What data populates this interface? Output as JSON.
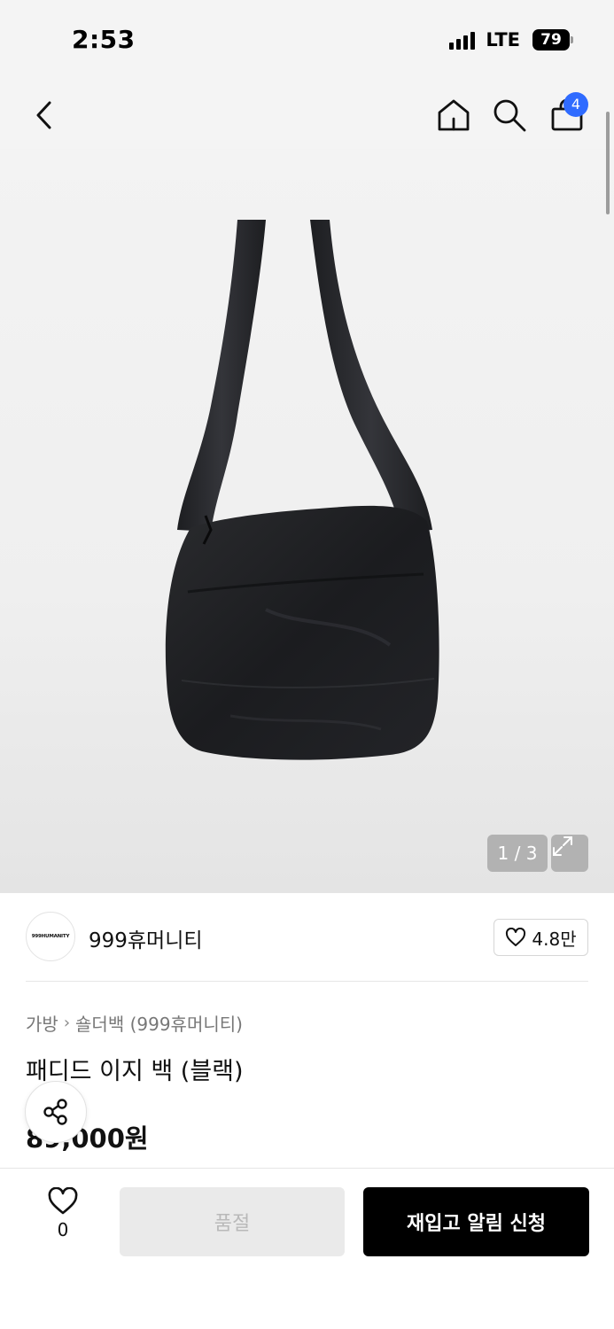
{
  "status_bar": {
    "time": "2:53",
    "network": "LTE",
    "battery": "79"
  },
  "nav": {
    "back_icon": "chevron-left-icon",
    "home_icon": "home-icon",
    "search_icon": "search-icon",
    "cart_icon": "shopping-bag-icon",
    "cart_count": "4",
    "badge_color": "#2f6bff"
  },
  "gallery": {
    "counter": "1 / 3",
    "expand_icon": "expand-icon"
  },
  "brand": {
    "logo_text": "999HUMANITY",
    "name": "999휴머니티",
    "like_count": "4.8만"
  },
  "breadcrumb": {
    "category": "가방",
    "subcategory": "숄더백 (999휴머니티)"
  },
  "product": {
    "title": "패디드 이지 백 (블랙)",
    "price": "89,000원"
  },
  "bottom_bar": {
    "wish_count": "0",
    "soldout_label": "품절",
    "restock_label": "재입고 알림 신청",
    "primary_color": "#000000"
  }
}
